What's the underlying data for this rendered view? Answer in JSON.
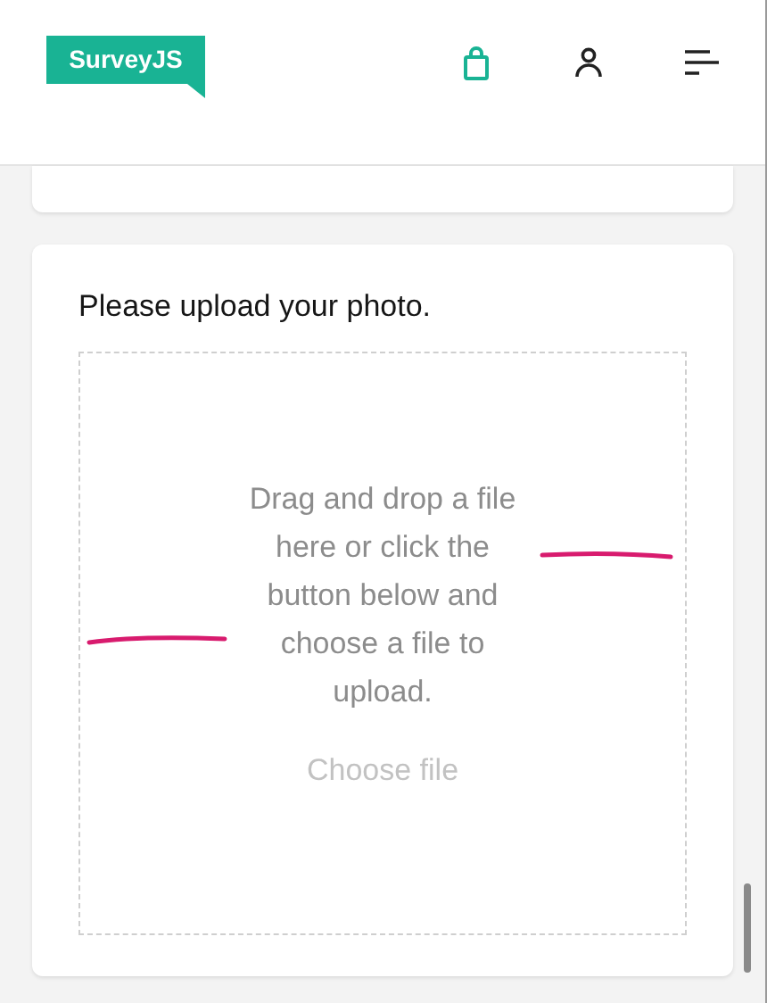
{
  "header": {
    "logo": "SurveyJS"
  },
  "question": {
    "title": "Please upload your photo.",
    "drop_text": "Drag and drop a file here or click the button below and choose a file to upload.",
    "button": "Choose file"
  }
}
